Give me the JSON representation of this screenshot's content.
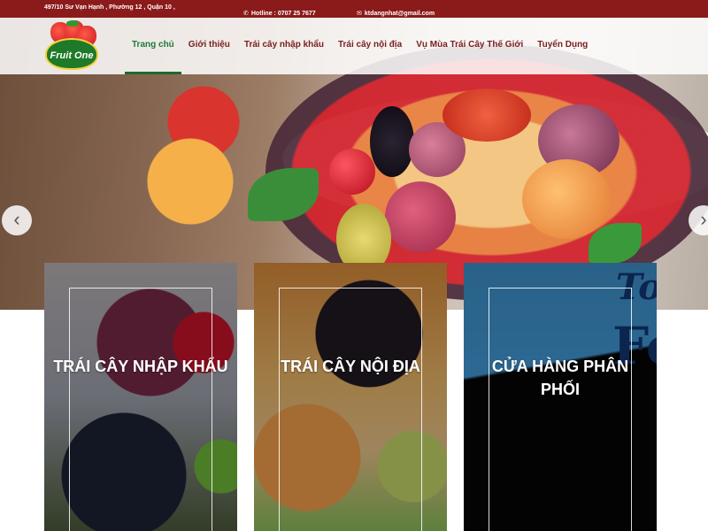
{
  "topbar": {
    "address": "497/10 Sư Vạn Hạnh , Phường 12 , Quận 10 ,",
    "hotline": "Hotline : 0707 25 7677",
    "email": "ktdangnhat@gmail.com",
    "phone_icon": "phone-icon",
    "mail_icon": "envelope-icon"
  },
  "brand": {
    "logo_text": "Fruit One"
  },
  "nav": {
    "items": [
      {
        "label": "Trang chủ",
        "active": true
      },
      {
        "label": "Giới thiệu"
      },
      {
        "label": "Trái cây nhập khẩu"
      },
      {
        "label": "Trái cây nội địa"
      },
      {
        "label": "Vụ Mùa Trái Cây Thế Giới"
      },
      {
        "label": "Tuyển Dụng"
      }
    ]
  },
  "slider": {
    "prev_icon": "chevron-left-icon",
    "next_icon": "chevron-right-icon"
  },
  "cards": [
    {
      "title": "TRÁI CÂY NHẬP KHẨU"
    },
    {
      "title": "TRÁI CÂY NỘI ĐỊA"
    },
    {
      "title": "CỬA HÀNG PHÂN PHỐI",
      "bg_text_1": "To",
      "bg_text_2": "Fo"
    }
  ],
  "colors": {
    "topbar": "#8b1a1a",
    "nav_text": "#7a1d1d",
    "nav_active": "#1e7a3a",
    "logo_green": "#1e7a28"
  }
}
